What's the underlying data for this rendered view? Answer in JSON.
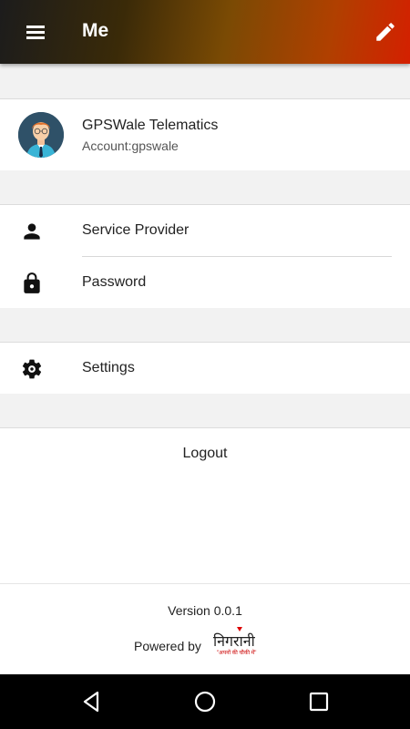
{
  "appbar": {
    "title": "Me"
  },
  "profile": {
    "name": "GPSWale Telematics",
    "account": "Account:gpswale"
  },
  "menu": [
    {
      "label": "Service Provider",
      "icon": "person-icon"
    },
    {
      "label": "Password",
      "icon": "lock-icon"
    }
  ],
  "settings": {
    "label": "Settings",
    "icon": "gear-icon"
  },
  "logout": {
    "label": "Logout"
  },
  "footer": {
    "version": "Version 0.0.1",
    "powered_by": "Powered by",
    "logo_text": "निगरानी",
    "logo_tagline": "\"अपनों की चौकी में\""
  },
  "colors": {
    "appbar_start": "#1c1c1c",
    "appbar_end": "#d42000",
    "background": "#f2f2f2"
  }
}
